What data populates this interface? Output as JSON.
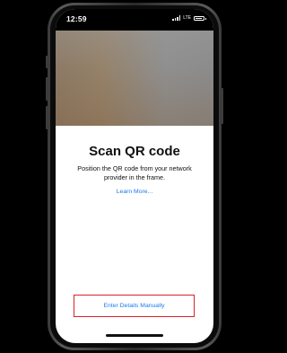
{
  "status_bar": {
    "time": "12:59",
    "network": "LTE"
  },
  "scan_screen": {
    "title": "Scan QR code",
    "instructions": "Position the QR code from your network provider in the frame.",
    "learn_more": "Learn More...",
    "manual_entry": "Enter Details Manually"
  },
  "colors": {
    "link": "#1a7ae8",
    "highlight_box": "#d9232d"
  }
}
